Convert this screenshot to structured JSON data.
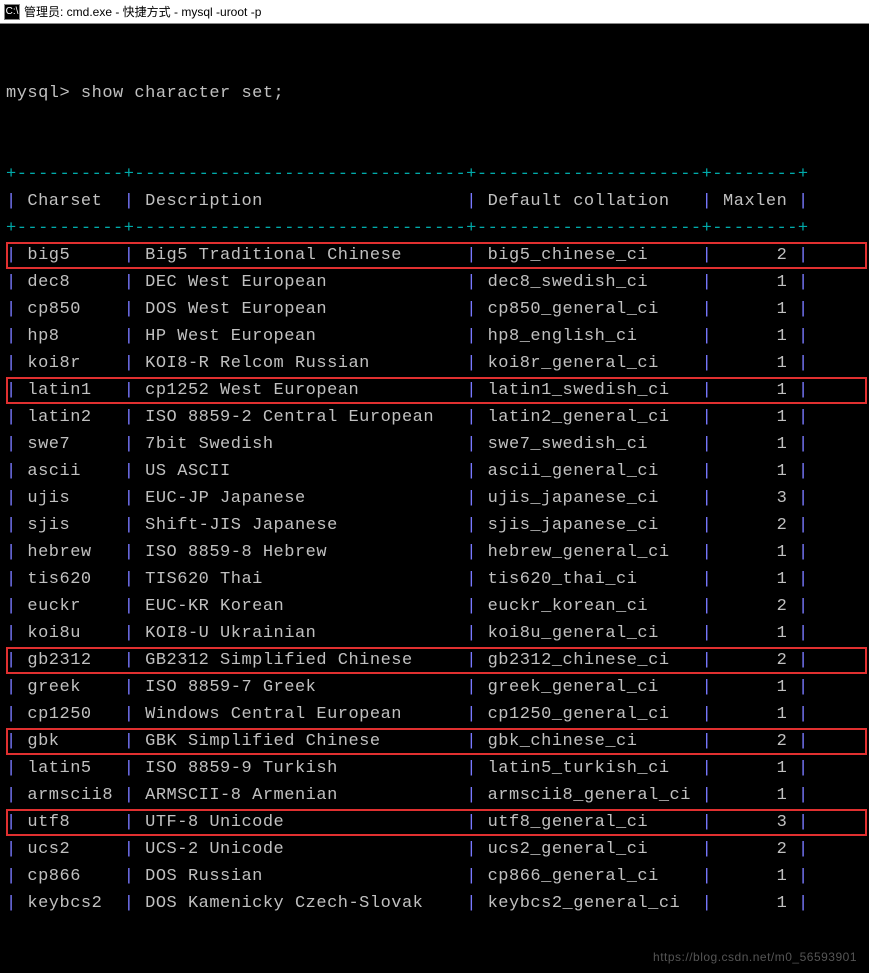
{
  "window": {
    "icon_label": "C:\\",
    "title": "管理员: cmd.exe - 快捷方式 - mysql  -uroot -p"
  },
  "prompt": {
    "label": "mysql>",
    "command": "show character set;"
  },
  "table": {
    "headers": {
      "charset": "Charset",
      "description": "Description",
      "collation": "Default collation",
      "maxlen": "Maxlen"
    },
    "rows": [
      {
        "charset": "big5",
        "description": "Big5 Traditional Chinese",
        "collation": "big5_chinese_ci",
        "maxlen": "2",
        "highlighted": true
      },
      {
        "charset": "dec8",
        "description": "DEC West European",
        "collation": "dec8_swedish_ci",
        "maxlen": "1",
        "highlighted": false
      },
      {
        "charset": "cp850",
        "description": "DOS West European",
        "collation": "cp850_general_ci",
        "maxlen": "1",
        "highlighted": false
      },
      {
        "charset": "hp8",
        "description": "HP West European",
        "collation": "hp8_english_ci",
        "maxlen": "1",
        "highlighted": false
      },
      {
        "charset": "koi8r",
        "description": "KOI8-R Relcom Russian",
        "collation": "koi8r_general_ci",
        "maxlen": "1",
        "highlighted": false
      },
      {
        "charset": "latin1",
        "description": "cp1252 West European",
        "collation": "latin1_swedish_ci",
        "maxlen": "1",
        "highlighted": true
      },
      {
        "charset": "latin2",
        "description": "ISO 8859-2 Central European",
        "collation": "latin2_general_ci",
        "maxlen": "1",
        "highlighted": false
      },
      {
        "charset": "swe7",
        "description": "7bit Swedish",
        "collation": "swe7_swedish_ci",
        "maxlen": "1",
        "highlighted": false
      },
      {
        "charset": "ascii",
        "description": "US ASCII",
        "collation": "ascii_general_ci",
        "maxlen": "1",
        "highlighted": false
      },
      {
        "charset": "ujis",
        "description": "EUC-JP Japanese",
        "collation": "ujis_japanese_ci",
        "maxlen": "3",
        "highlighted": false
      },
      {
        "charset": "sjis",
        "description": "Shift-JIS Japanese",
        "collation": "sjis_japanese_ci",
        "maxlen": "2",
        "highlighted": false
      },
      {
        "charset": "hebrew",
        "description": "ISO 8859-8 Hebrew",
        "collation": "hebrew_general_ci",
        "maxlen": "1",
        "highlighted": false
      },
      {
        "charset": "tis620",
        "description": "TIS620 Thai",
        "collation": "tis620_thai_ci",
        "maxlen": "1",
        "highlighted": false
      },
      {
        "charset": "euckr",
        "description": "EUC-KR Korean",
        "collation": "euckr_korean_ci",
        "maxlen": "2",
        "highlighted": false
      },
      {
        "charset": "koi8u",
        "description": "KOI8-U Ukrainian",
        "collation": "koi8u_general_ci",
        "maxlen": "1",
        "highlighted": false
      },
      {
        "charset": "gb2312",
        "description": "GB2312 Simplified Chinese",
        "collation": "gb2312_chinese_ci",
        "maxlen": "2",
        "highlighted": true
      },
      {
        "charset": "greek",
        "description": "ISO 8859-7 Greek",
        "collation": "greek_general_ci",
        "maxlen": "1",
        "highlighted": false
      },
      {
        "charset": "cp1250",
        "description": "Windows Central European",
        "collation": "cp1250_general_ci",
        "maxlen": "1",
        "highlighted": false
      },
      {
        "charset": "gbk",
        "description": "GBK Simplified Chinese",
        "collation": "gbk_chinese_ci",
        "maxlen": "2",
        "highlighted": true
      },
      {
        "charset": "latin5",
        "description": "ISO 8859-9 Turkish",
        "collation": "latin5_turkish_ci",
        "maxlen": "1",
        "highlighted": false
      },
      {
        "charset": "armscii8",
        "description": "ARMSCII-8 Armenian",
        "collation": "armscii8_general_ci",
        "maxlen": "1",
        "highlighted": false
      },
      {
        "charset": "utf8",
        "description": "UTF-8 Unicode",
        "collation": "utf8_general_ci",
        "maxlen": "3",
        "highlighted": true
      },
      {
        "charset": "ucs2",
        "description": "UCS-2 Unicode",
        "collation": "ucs2_general_ci",
        "maxlen": "2",
        "highlighted": false
      },
      {
        "charset": "cp866",
        "description": "DOS Russian",
        "collation": "cp866_general_ci",
        "maxlen": "1",
        "highlighted": false
      },
      {
        "charset": "keybcs2",
        "description": "DOS Kamenicky Czech-Slovak",
        "collation": "keybcs2_general_ci",
        "maxlen": "1",
        "highlighted": false
      }
    ]
  },
  "widths": {
    "charset": 10,
    "description": 31,
    "collation": 21,
    "maxlen": 8
  },
  "watermark": "https://blog.csdn.net/m0_56593901"
}
